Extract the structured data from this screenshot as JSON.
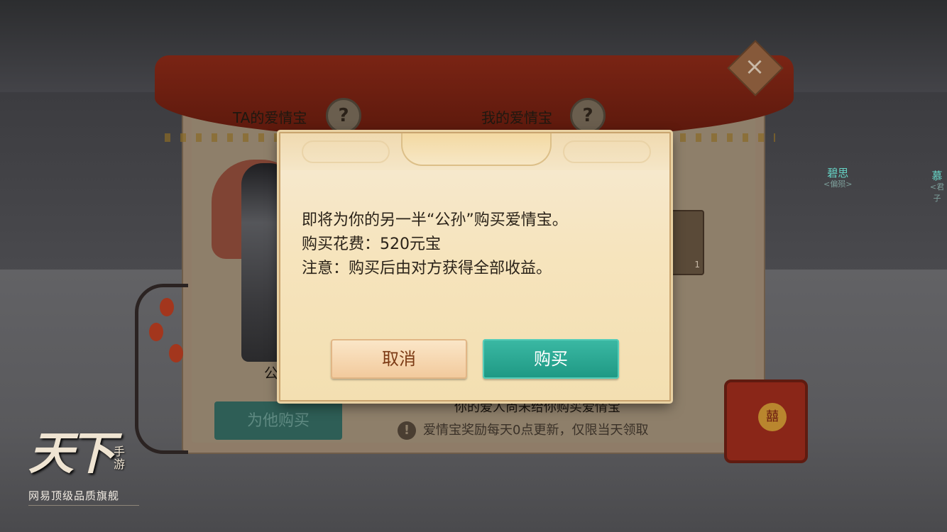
{
  "panel": {
    "ta_love_treasure": "TA的爱情宝",
    "my_love_treasure": "我的爱情宝",
    "help_glyph": "?",
    "character_name": "公",
    "buy_for_him": "为他购买",
    "notice": "你的爱人尚未给你购买爱情宝",
    "tip": "爱情宝奖励每天0点更新，仅限当天领取",
    "item_count": "1",
    "close_glyph": "×"
  },
  "npcs": [
    {
      "name": "碧思",
      "sub": "<偏殒>"
    },
    {
      "name": "慕",
      "sub": "<君子"
    }
  ],
  "dialog": {
    "line1": "即将为你的另一半“公孙”购买爱情宝。",
    "line2": "购买花费：520元宝",
    "line3": "注意：购买后由对方获得全部收益。",
    "cancel_label": "取消",
    "buy_label": "购买"
  },
  "logo": {
    "main": "天下",
    "side": "手游",
    "tagline": "网易顶级品质旗舰"
  },
  "gift_seal": "囍",
  "colors": {
    "accent_teal": "#2aa893",
    "dialog_bg": "#f6e4bd",
    "cancel_text": "#7c3a14",
    "npc_name": "#66d4c6"
  }
}
